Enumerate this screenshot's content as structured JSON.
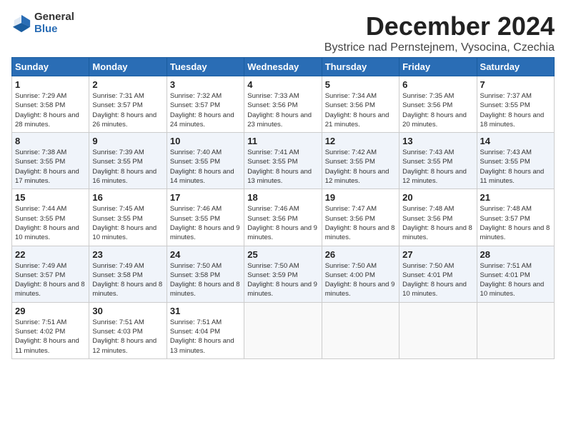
{
  "logo": {
    "general": "General",
    "blue": "Blue"
  },
  "header": {
    "month_title": "December 2024",
    "subtitle": "Bystrice nad Pernstejnem, Vysocina, Czechia"
  },
  "weekdays": [
    "Sunday",
    "Monday",
    "Tuesday",
    "Wednesday",
    "Thursday",
    "Friday",
    "Saturday"
  ],
  "weeks": [
    [
      {
        "day": "1",
        "sunrise": "Sunrise: 7:29 AM",
        "sunset": "Sunset: 3:58 PM",
        "daylight": "Daylight: 8 hours and 28 minutes."
      },
      {
        "day": "2",
        "sunrise": "Sunrise: 7:31 AM",
        "sunset": "Sunset: 3:57 PM",
        "daylight": "Daylight: 8 hours and 26 minutes."
      },
      {
        "day": "3",
        "sunrise": "Sunrise: 7:32 AM",
        "sunset": "Sunset: 3:57 PM",
        "daylight": "Daylight: 8 hours and 24 minutes."
      },
      {
        "day": "4",
        "sunrise": "Sunrise: 7:33 AM",
        "sunset": "Sunset: 3:56 PM",
        "daylight": "Daylight: 8 hours and 23 minutes."
      },
      {
        "day": "5",
        "sunrise": "Sunrise: 7:34 AM",
        "sunset": "Sunset: 3:56 PM",
        "daylight": "Daylight: 8 hours and 21 minutes."
      },
      {
        "day": "6",
        "sunrise": "Sunrise: 7:35 AM",
        "sunset": "Sunset: 3:56 PM",
        "daylight": "Daylight: 8 hours and 20 minutes."
      },
      {
        "day": "7",
        "sunrise": "Sunrise: 7:37 AM",
        "sunset": "Sunset: 3:55 PM",
        "daylight": "Daylight: 8 hours and 18 minutes."
      }
    ],
    [
      {
        "day": "8",
        "sunrise": "Sunrise: 7:38 AM",
        "sunset": "Sunset: 3:55 PM",
        "daylight": "Daylight: 8 hours and 17 minutes."
      },
      {
        "day": "9",
        "sunrise": "Sunrise: 7:39 AM",
        "sunset": "Sunset: 3:55 PM",
        "daylight": "Daylight: 8 hours and 16 minutes."
      },
      {
        "day": "10",
        "sunrise": "Sunrise: 7:40 AM",
        "sunset": "Sunset: 3:55 PM",
        "daylight": "Daylight: 8 hours and 14 minutes."
      },
      {
        "day": "11",
        "sunrise": "Sunrise: 7:41 AM",
        "sunset": "Sunset: 3:55 PM",
        "daylight": "Daylight: 8 hours and 13 minutes."
      },
      {
        "day": "12",
        "sunrise": "Sunrise: 7:42 AM",
        "sunset": "Sunset: 3:55 PM",
        "daylight": "Daylight: 8 hours and 12 minutes."
      },
      {
        "day": "13",
        "sunrise": "Sunrise: 7:43 AM",
        "sunset": "Sunset: 3:55 PM",
        "daylight": "Daylight: 8 hours and 12 minutes."
      },
      {
        "day": "14",
        "sunrise": "Sunrise: 7:43 AM",
        "sunset": "Sunset: 3:55 PM",
        "daylight": "Daylight: 8 hours and 11 minutes."
      }
    ],
    [
      {
        "day": "15",
        "sunrise": "Sunrise: 7:44 AM",
        "sunset": "Sunset: 3:55 PM",
        "daylight": "Daylight: 8 hours and 10 minutes."
      },
      {
        "day": "16",
        "sunrise": "Sunrise: 7:45 AM",
        "sunset": "Sunset: 3:55 PM",
        "daylight": "Daylight: 8 hours and 10 minutes."
      },
      {
        "day": "17",
        "sunrise": "Sunrise: 7:46 AM",
        "sunset": "Sunset: 3:55 PM",
        "daylight": "Daylight: 8 hours and 9 minutes."
      },
      {
        "day": "18",
        "sunrise": "Sunrise: 7:46 AM",
        "sunset": "Sunset: 3:56 PM",
        "daylight": "Daylight: 8 hours and 9 minutes."
      },
      {
        "day": "19",
        "sunrise": "Sunrise: 7:47 AM",
        "sunset": "Sunset: 3:56 PM",
        "daylight": "Daylight: 8 hours and 8 minutes."
      },
      {
        "day": "20",
        "sunrise": "Sunrise: 7:48 AM",
        "sunset": "Sunset: 3:56 PM",
        "daylight": "Daylight: 8 hours and 8 minutes."
      },
      {
        "day": "21",
        "sunrise": "Sunrise: 7:48 AM",
        "sunset": "Sunset: 3:57 PM",
        "daylight": "Daylight: 8 hours and 8 minutes."
      }
    ],
    [
      {
        "day": "22",
        "sunrise": "Sunrise: 7:49 AM",
        "sunset": "Sunset: 3:57 PM",
        "daylight": "Daylight: 8 hours and 8 minutes."
      },
      {
        "day": "23",
        "sunrise": "Sunrise: 7:49 AM",
        "sunset": "Sunset: 3:58 PM",
        "daylight": "Daylight: 8 hours and 8 minutes."
      },
      {
        "day": "24",
        "sunrise": "Sunrise: 7:50 AM",
        "sunset": "Sunset: 3:58 PM",
        "daylight": "Daylight: 8 hours and 8 minutes."
      },
      {
        "day": "25",
        "sunrise": "Sunrise: 7:50 AM",
        "sunset": "Sunset: 3:59 PM",
        "daylight": "Daylight: 8 hours and 9 minutes."
      },
      {
        "day": "26",
        "sunrise": "Sunrise: 7:50 AM",
        "sunset": "Sunset: 4:00 PM",
        "daylight": "Daylight: 8 hours and 9 minutes."
      },
      {
        "day": "27",
        "sunrise": "Sunrise: 7:50 AM",
        "sunset": "Sunset: 4:01 PM",
        "daylight": "Daylight: 8 hours and 10 minutes."
      },
      {
        "day": "28",
        "sunrise": "Sunrise: 7:51 AM",
        "sunset": "Sunset: 4:01 PM",
        "daylight": "Daylight: 8 hours and 10 minutes."
      }
    ],
    [
      {
        "day": "29",
        "sunrise": "Sunrise: 7:51 AM",
        "sunset": "Sunset: 4:02 PM",
        "daylight": "Daylight: 8 hours and 11 minutes."
      },
      {
        "day": "30",
        "sunrise": "Sunrise: 7:51 AM",
        "sunset": "Sunset: 4:03 PM",
        "daylight": "Daylight: 8 hours and 12 minutes."
      },
      {
        "day": "31",
        "sunrise": "Sunrise: 7:51 AM",
        "sunset": "Sunset: 4:04 PM",
        "daylight": "Daylight: 8 hours and 13 minutes."
      },
      null,
      null,
      null,
      null
    ]
  ]
}
